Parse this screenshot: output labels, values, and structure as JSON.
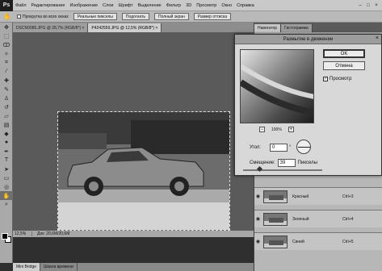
{
  "app": {
    "logo": "Ps"
  },
  "menu": [
    "Файл",
    "Редактирование",
    "Изображение",
    "Слои",
    "Шрифт",
    "Выделение",
    "Фильтр",
    "3D",
    "Просмотр",
    "Окно",
    "Справка"
  ],
  "options_bar": {
    "checkbox_label": "Прокрутка во всех окнах",
    "buttons": [
      "Реальные пикселы",
      "Подогнать",
      "Полный экран",
      "Размер оттиска"
    ]
  },
  "doc_tabs": [
    {
      "label": "DSCN0085.JPG @ 28,7% (RGB/8*) ×",
      "active": false
    },
    {
      "label": "P4242559.JPG @ 12,5% (RGB/8*) ×",
      "active": true
    }
  ],
  "status": {
    "zoom": "12,5%",
    "doc": "Док: 20,6M/20,6M"
  },
  "bottom_tabs": [
    "Mini Bridge",
    "Шкала времени"
  ],
  "panel_tabs": [
    "Навигатор",
    "Гистограмма"
  ],
  "layers": [
    {
      "name": "Красный",
      "shortcut": "Ctrl+3"
    },
    {
      "name": "Зеленый",
      "shortcut": "Ctrl+4"
    },
    {
      "name": "Синий",
      "shortcut": "Ctrl+5"
    }
  ],
  "dialog": {
    "title": "Размытие в движении",
    "ok": "OK",
    "cancel": "Отмена",
    "preview_label": "Просмотр",
    "preview_checked": true,
    "zoom": "100%",
    "angle_label": "Угол:",
    "angle_value": "0",
    "angle_unit": "°",
    "distance_label": "Смещение:",
    "distance_value": "39",
    "distance_unit": "Пикселы",
    "distance_fraction": 0.2
  },
  "colors": {
    "foreground": "#000000",
    "background": "#ffffff"
  }
}
